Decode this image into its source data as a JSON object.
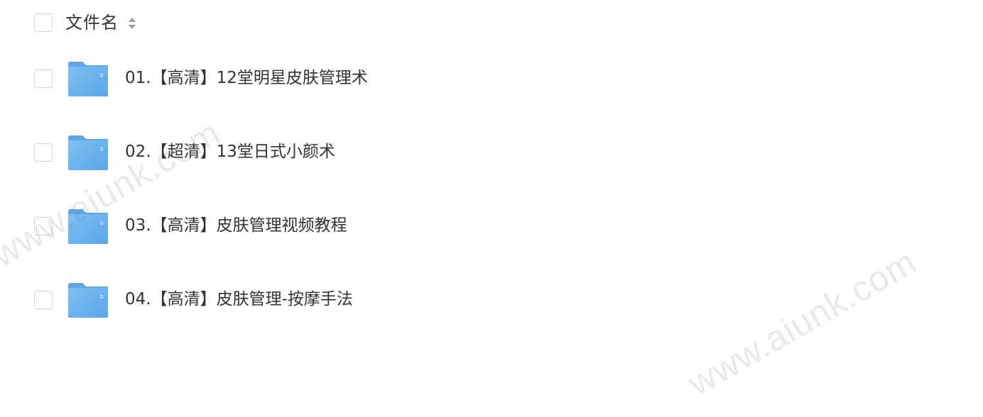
{
  "header": {
    "column_label": "文件名",
    "sort_icon": "sort-icon"
  },
  "files": [
    {
      "name": "01.【高清】12堂明星皮肤管理术",
      "icon": "folder-icon"
    },
    {
      "name": "02.【超清】13堂日式小颜术",
      "icon": "folder-icon"
    },
    {
      "name": "03.【高清】皮肤管理视频教程",
      "icon": "folder-icon"
    },
    {
      "name": "04.【高清】皮肤管理-按摩手法",
      "icon": "folder-icon"
    }
  ],
  "watermarks": [
    "www.aiunk.com",
    "www.aiunk.com"
  ],
  "colors": {
    "folder": "#6cb1ee",
    "text": "#333333",
    "checkbox_border": "#d6d6d6"
  }
}
